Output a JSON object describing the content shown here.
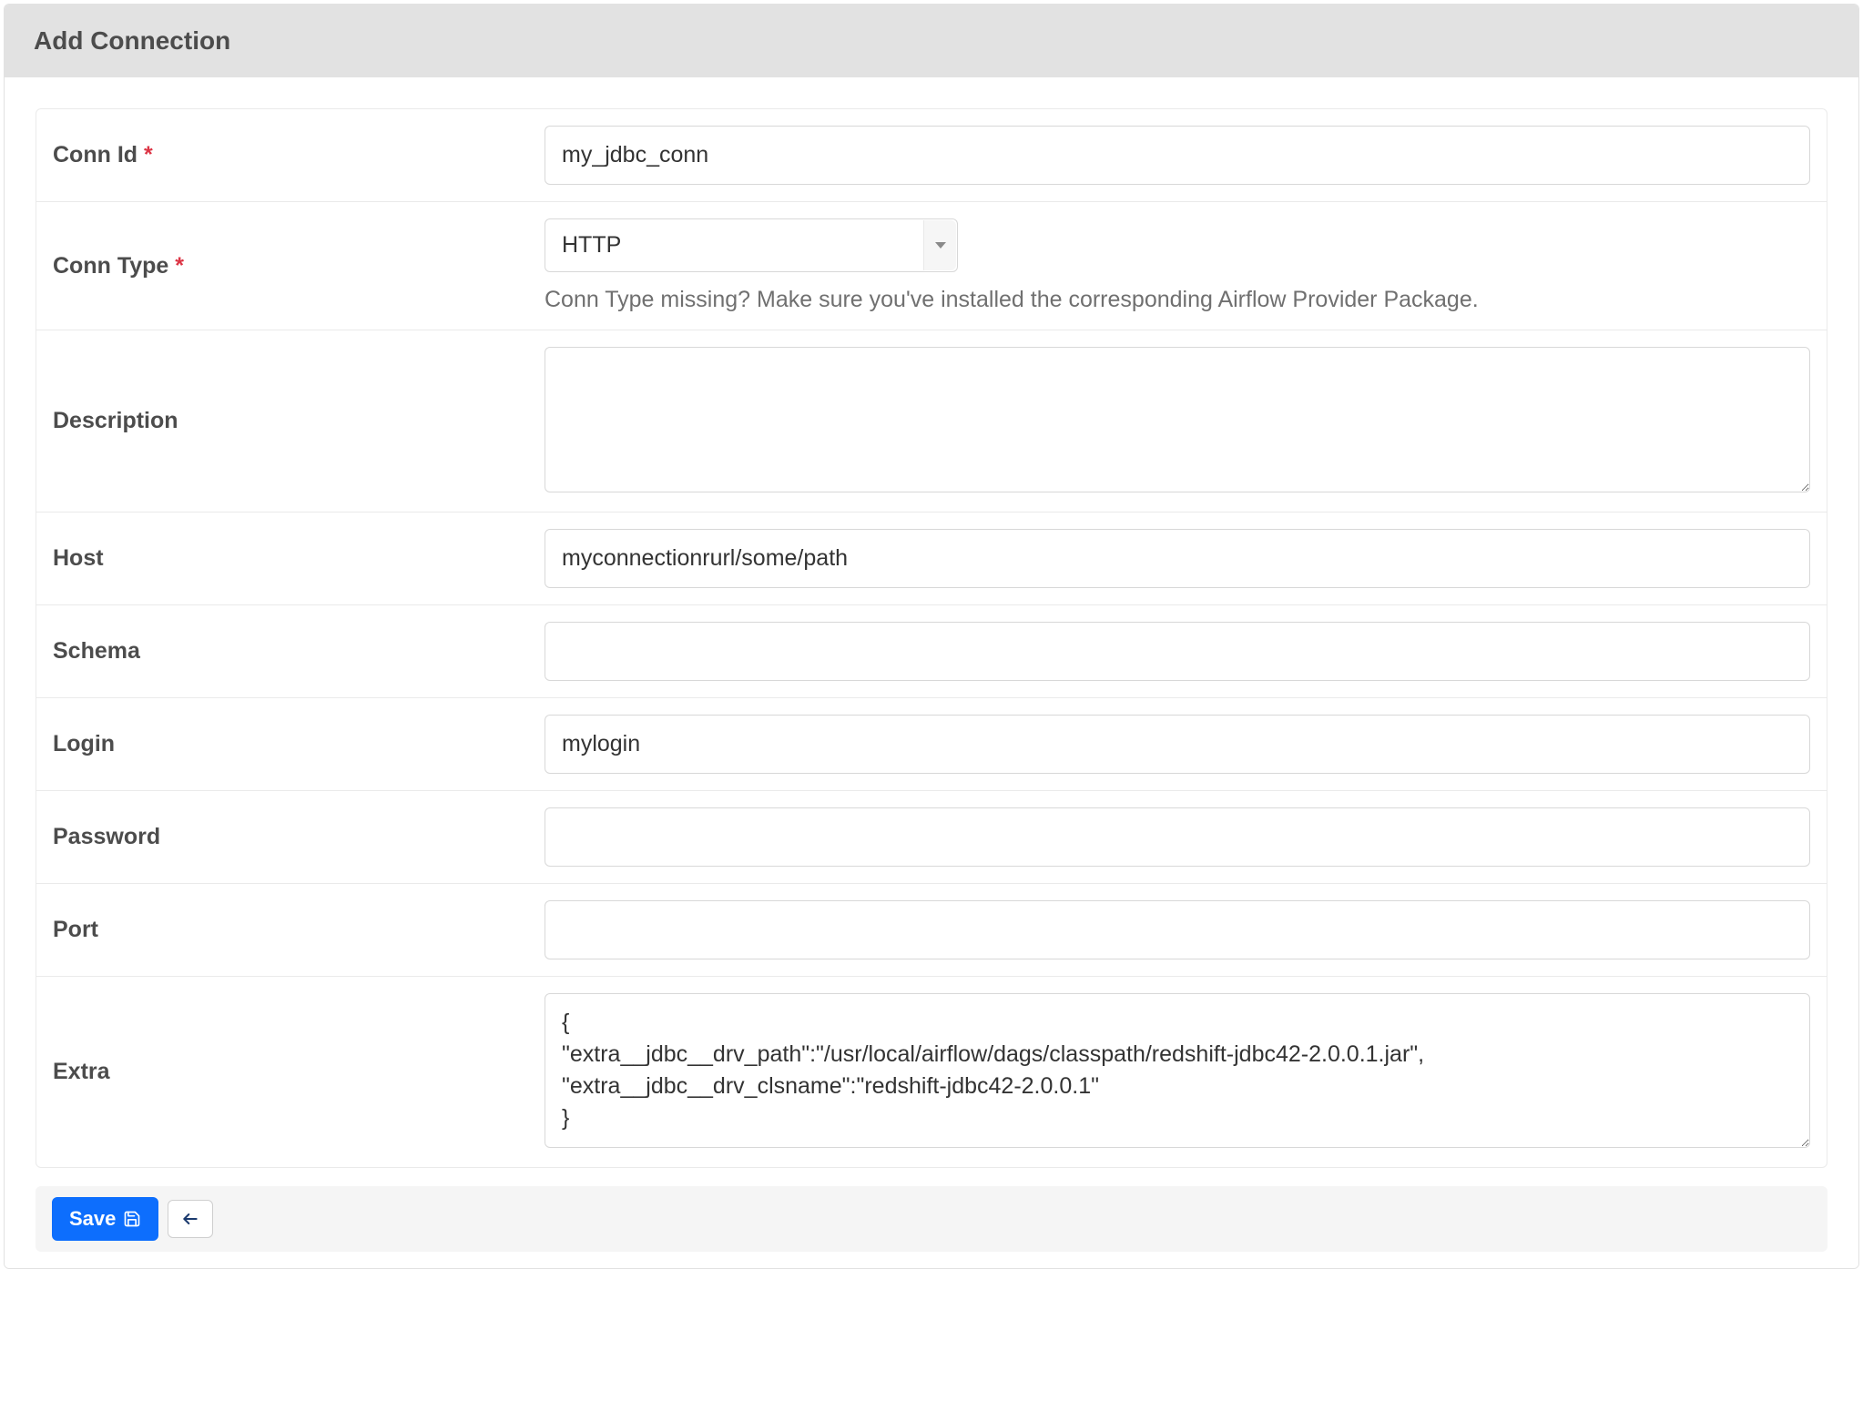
{
  "header": {
    "title": "Add Connection"
  },
  "form": {
    "conn_id": {
      "label": "Conn Id",
      "required": true,
      "value": "my_jdbc_conn"
    },
    "conn_type": {
      "label": "Conn Type",
      "required": true,
      "value": "HTTP",
      "help": "Conn Type missing? Make sure you've installed the corresponding Airflow Provider Package."
    },
    "description": {
      "label": "Description",
      "required": false,
      "value": ""
    },
    "host": {
      "label": "Host",
      "required": false,
      "value": "myconnectionrurl/some/path"
    },
    "schema": {
      "label": "Schema",
      "required": false,
      "value": ""
    },
    "login": {
      "label": "Login",
      "required": false,
      "value": "mylogin"
    },
    "password": {
      "label": "Password",
      "required": false,
      "value": ""
    },
    "port": {
      "label": "Port",
      "required": false,
      "value": ""
    },
    "extra": {
      "label": "Extra",
      "required": false,
      "value": "{\n\"extra__jdbc__drv_path\":\"/usr/local/airflow/dags/classpath/redshift-jdbc42-2.0.0.1.jar\",\n\"extra__jdbc__drv_clsname\":\"redshift-jdbc42-2.0.0.1\"\n}"
    }
  },
  "actions": {
    "save_label": "Save",
    "back_label": "Back"
  },
  "required_marker": "*"
}
